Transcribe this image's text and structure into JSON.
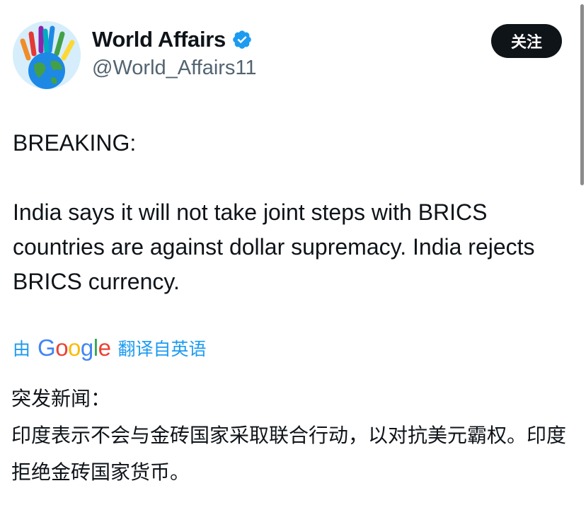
{
  "author": {
    "display_name": "World Affairs",
    "handle": "@World_Affairs11",
    "verified_icon": "verified-badge-icon",
    "avatar_icon": "globe-hands-icon"
  },
  "follow_button": {
    "label": "关注"
  },
  "tweet": {
    "line1": "BREAKING:",
    "line2": "India says it will not take joint steps with BRICS countries are against dollar supremacy. India rejects BRICS currency."
  },
  "translation": {
    "prefix": "由",
    "provider": "Google",
    "suffix": "翻译自英语",
    "line1": "突发新闻：",
    "line2": "印度表示不会与金砖国家采取联合行动，以对抗美元霸权。印度拒绝金砖国家货币。"
  },
  "colors": {
    "link": "#1d9bf0",
    "verified": "#1d9bf0",
    "button_bg": "#0f1419"
  }
}
